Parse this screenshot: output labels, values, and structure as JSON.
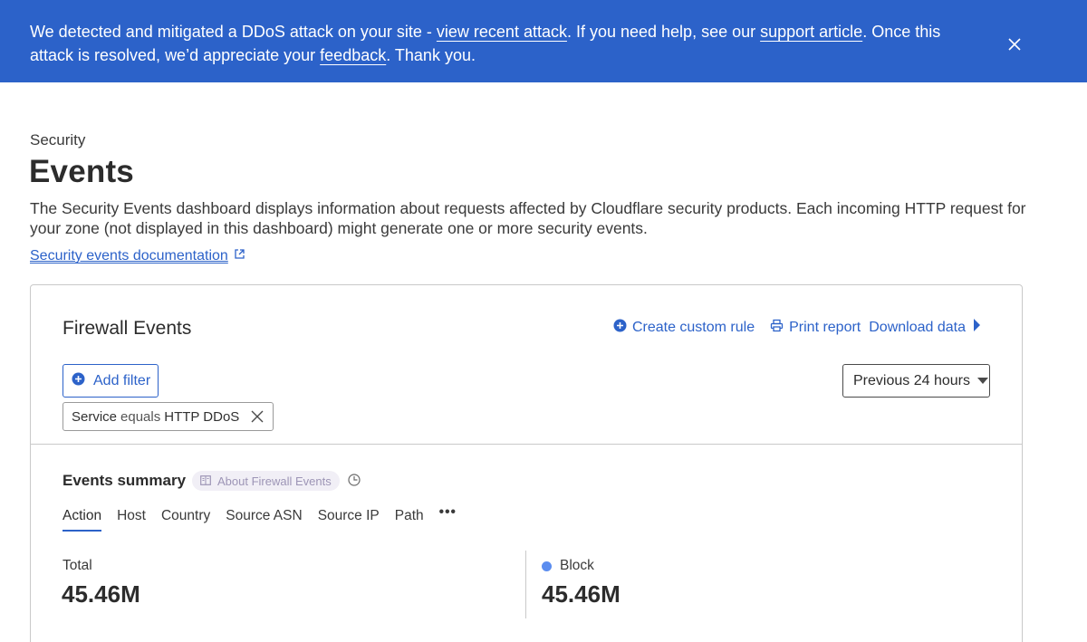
{
  "banner": {
    "text_1": "We detected and mitigated a DDoS attack on your site - ",
    "link_recent_attack": "view recent attack",
    "text_2": ". If you need help, see our ",
    "link_support": "support article",
    "text_3": ". Once this attack is resolved, we’d appreciate your ",
    "link_feedback": "feedback",
    "text_4": ". Thank you.",
    "background_color": "#2c62c9",
    "close_icon": "close-icon"
  },
  "header": {
    "eyebrow": "Security",
    "title": "Events",
    "description": "The Security Events dashboard displays information about requests affected by Cloudflare security products. Each incoming HTTP request for your zone (not displayed in this dashboard) might generate one or more security events.",
    "doc_link": "Security events documentation",
    "doc_link_icon": "external-link-icon"
  },
  "card": {
    "title": "Firewall Events",
    "actions": {
      "create_rule": "Create custom rule",
      "print_report": "Print report",
      "download_data": "Download data"
    },
    "add_filter": "Add filter",
    "time_range": "Previous 24 hours",
    "filter_chip": {
      "field": "Service",
      "operator": "equals",
      "value": "HTTP DDoS"
    },
    "summary": {
      "title": "Events summary",
      "about_badge": "About Firewall Events",
      "tabs": [
        "Action",
        "Host",
        "Country",
        "Source ASN",
        "Source IP",
        "Path"
      ],
      "active_tab": "Action",
      "more": "•••",
      "total_label": "Total",
      "total_value": "45.46M",
      "block_label": "Block",
      "block_value": "45.46M",
      "block_color": "#5b8def"
    }
  },
  "colors": {
    "accent": "#2c62c9"
  }
}
